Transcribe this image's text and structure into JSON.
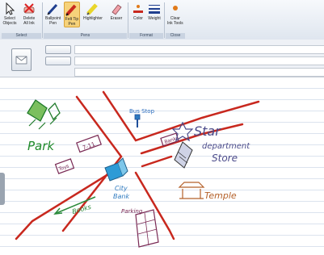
{
  "ribbon": {
    "buttons": [
      {
        "label": "Select\nObjects",
        "icon": "arrow-cursor-icon"
      },
      {
        "label": "Delete\nAll Ink",
        "icon": "eraser-x-icon"
      },
      {
        "label": "Ballpoint\nPen",
        "icon": "pen-icon"
      },
      {
        "label": "Felt Tip\nPen",
        "icon": "felt-pen-icon"
      },
      {
        "label": "Highlighter",
        "icon": "highlighter-icon"
      },
      {
        "label": "Eraser",
        "icon": "eraser-icon"
      },
      {
        "label": "Color",
        "icon": "color-icon"
      },
      {
        "label": "Weight",
        "icon": "weight-icon"
      },
      {
        "label": "Clear\nInk Tools",
        "icon": "clear-icon"
      }
    ],
    "groups": [
      "Select",
      "Pens",
      "Format",
      "Close"
    ]
  },
  "colors": {
    "pen_red": "#c8281e",
    "accent": "#f6d27a"
  },
  "sketch": {
    "park": "Park",
    "seven_eleven": "7-11",
    "bus_stop": "Bus Stop",
    "bank": "Bank",
    "star_dept": [
      "Star",
      "department",
      "Store"
    ],
    "toy_shop": "Toys",
    "temple": "Temple",
    "books": "Books",
    "city_bank": [
      "City",
      "Bank"
    ],
    "parking": "Parking"
  }
}
